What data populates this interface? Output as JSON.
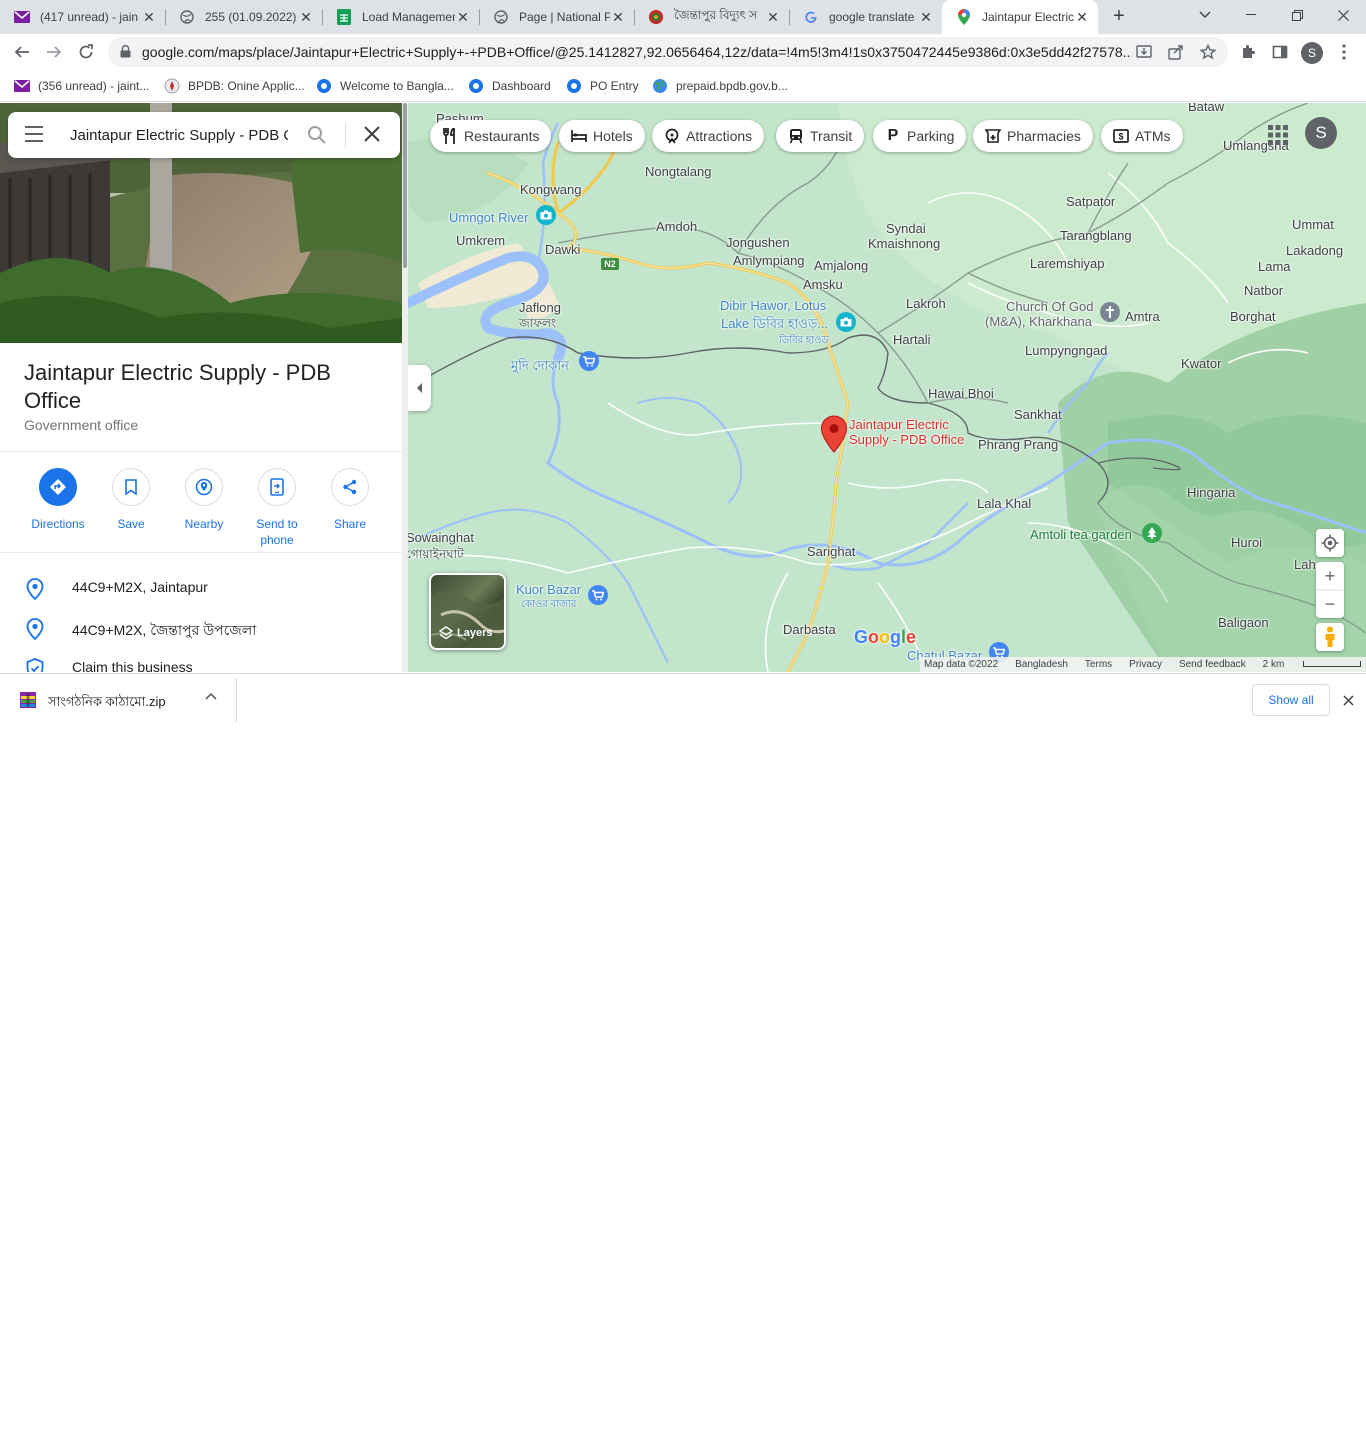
{
  "browser": {
    "tabs": [
      {
        "title": "(417 unread) - jain",
        "icon": "gmail-icon"
      },
      {
        "title": "255 (01.09.2022) -",
        "icon": "globe-icon"
      },
      {
        "title": "Load Managemen",
        "icon": "sheets-icon"
      },
      {
        "title": "Page | National Po",
        "icon": "globe-icon"
      },
      {
        "title": "জৈন্তাপুর বিদ্যুৎ স",
        "icon": "bd-emblem-icon"
      },
      {
        "title": "google translate",
        "icon": "google-icon"
      },
      {
        "title": "Jaintapur Electric",
        "icon": "maps-icon",
        "active": true
      }
    ],
    "new_tab_label": "+",
    "url": "google.com/maps/place/Jaintapur+Electric+Supply+-+PDB+Office/@25.1412827,92.0656464,12z/data=!4m5!3m4!1s0x3750472445e9386d:0x3e5dd42f27578...",
    "profile_initial": "S",
    "bookmarks": [
      {
        "label": "(356 unread) - jaint...",
        "icon": "gmail-icon"
      },
      {
        "label": "BPDB: Onine Applic...",
        "icon": "bpdb-icon"
      },
      {
        "label": "Welcome to Bangla...",
        "icon": "bpdb-icon"
      },
      {
        "label": "Dashboard",
        "icon": "bpdb-icon"
      },
      {
        "label": "PO Entry",
        "icon": "bpdb-icon"
      },
      {
        "label": "prepaid.bpdb.gov.b...",
        "icon": "globe-color-icon"
      }
    ]
  },
  "search": {
    "value": "Jaintapur Electric Supply - PDB Office"
  },
  "place": {
    "title": "Jaintapur Electric Supply - PDB Office",
    "category": "Government office",
    "actions": [
      {
        "label": "Directions",
        "icon": "directions-icon"
      },
      {
        "label": "Save",
        "icon": "bookmark-icon"
      },
      {
        "label": "Nearby",
        "icon": "nearby-icon"
      },
      {
        "label": "Send to phone",
        "icon": "send-to-phone-icon"
      },
      {
        "label": "Share",
        "icon": "share-icon"
      }
    ],
    "info": [
      {
        "text": "44C9+M2X, Jaintapur",
        "icon": "location-pin-icon"
      },
      {
        "text": "44C9+M2X, জৈন্তাপুর উপজেলা",
        "icon": "location-pin-icon"
      },
      {
        "text": "Claim this business",
        "icon": "verified-shield-icon"
      }
    ]
  },
  "map": {
    "chips": [
      {
        "label": "Restaurants",
        "icon": "restaurant-icon"
      },
      {
        "label": "Hotels",
        "icon": "hotel-icon"
      },
      {
        "label": "Attractions",
        "icon": "attractions-icon"
      },
      {
        "label": "Transit",
        "icon": "transit-icon"
      },
      {
        "label": "Parking",
        "icon": "parking-icon"
      },
      {
        "label": "Pharmacies",
        "icon": "pharmacy-icon"
      },
      {
        "label": "ATMs",
        "icon": "atm-icon"
      }
    ],
    "account_initial": "S",
    "labels": {
      "pashum": "Pashum",
      "bataw": "Bataw",
      "umlangshai": "Umlangsha",
      "kongwang": "Kongwang",
      "nongtalang": "Nongtalang",
      "umngot": "Umngot River",
      "umkrem": "Umkrem",
      "dawki": "Dawki",
      "amdoh": "Amdoh",
      "jongushen": "Jongushen",
      "amlympiang": "Amlympiang",
      "amjalong": "Amjalong",
      "syndai": "Syndai",
      "kmaishnong": "Kmaishnong",
      "satpator": "Satpator",
      "tarangblang": "Tarangblang",
      "ummat": "Ummat",
      "lakadong": "Lakadong",
      "lama": "Lama",
      "laremshiyap": "Laremshiyap",
      "natbor": "Natbor",
      "amsku": "Amsku",
      "jaflong": "Jaflong",
      "jaflong_bn": "জাফলং",
      "dibir1": "Dibir Hawor, Lotus",
      "dibir2": "Lake ডিবির হাওড়...",
      "dibir3": "ডিবির হাওড",
      "lakroh": "Lakroh",
      "church1": "Church Of God",
      "church2": "(M&A), Kharkhana",
      "amtra": "Amtra",
      "borghat": "Borghat",
      "hartali": "Hartali",
      "lumpyngngad": "Lumpyngngad",
      "mudi": "মুদি দোকান",
      "kwator": "Kwator",
      "hawaibhoi": "Hawai Bhoi",
      "sankhat": "Sankhat",
      "pin1": "Jaintapur Electric",
      "pin2": "Supply - PDB Office",
      "phrang": "Phrang Prang",
      "hingaria": "Hingaria",
      "lalakhal": "Lala Khal",
      "amtoli": "Amtoli tea garden",
      "sowainghat": "Sowainghat",
      "sowainghat_bn": "গোয়াইনঘাট",
      "sarighat": "Sarighat",
      "huroi": "Huroi",
      "lah": "Lah",
      "kuor1": "Kuor Bazar",
      "kuor2": "কোওর বাজার",
      "darbasta": "Darbasta",
      "chatul": "Chatul Bazar",
      "baligaon": "Baligaon",
      "n2": "N2"
    },
    "layers_label": "Layers",
    "google_logo": "Google",
    "attribution": [
      "Map data ©2022",
      "Bangladesh",
      "Terms",
      "Privacy",
      "Send feedback"
    ],
    "scale_label": "2 km",
    "zoom_in": "+",
    "zoom_out": "−"
  },
  "downloads": {
    "file_name": "সাংগঠনিক কাঠামো.zip",
    "show_all": "Show all"
  },
  "colors": {
    "accent": "#1a73e8",
    "pin": "#ea4335",
    "map_green": "#bfe3c8",
    "water": "#9cc0f9"
  }
}
